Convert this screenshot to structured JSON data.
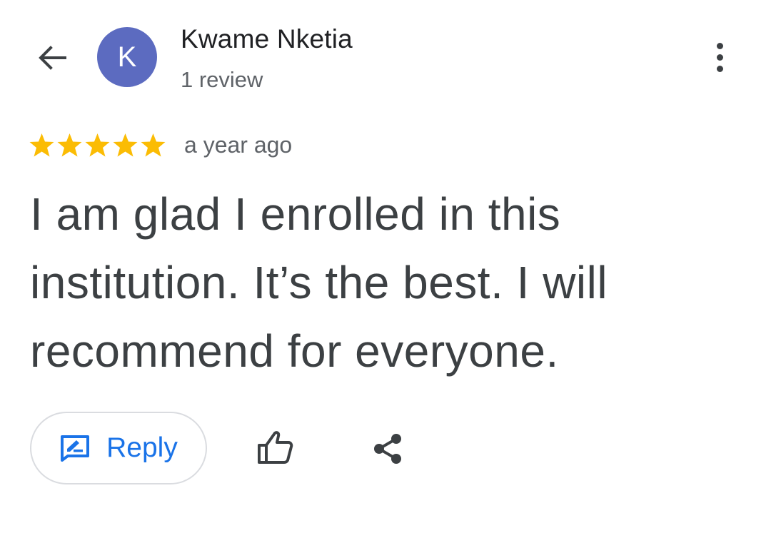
{
  "header": {
    "back_icon": "arrow-back-icon",
    "avatar_letter": "K",
    "avatar_color": "#5c6bc0",
    "reviewer_name": "Kwame Nketia",
    "review_count": "1 review",
    "more_icon": "more-vert-icon"
  },
  "review": {
    "rating": 5,
    "rating_max": 5,
    "star_color": "#fbbc04",
    "time": "a year ago",
    "text": "I am glad I enrolled in this institution. It’s the best. I will recommend for everyone."
  },
  "actions": {
    "reply_label": "Reply",
    "reply_icon": "rate-review-icon",
    "like_icon": "thumb-up-icon",
    "share_icon": "share-icon",
    "accent_color": "#1a73e8"
  }
}
